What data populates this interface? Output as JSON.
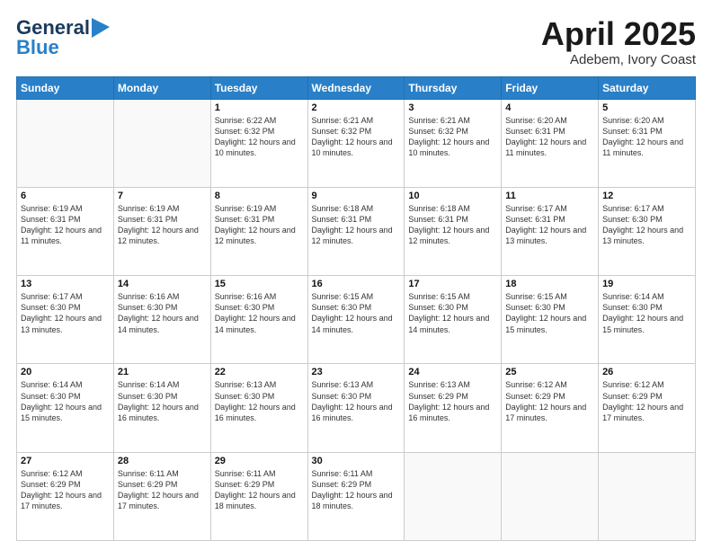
{
  "header": {
    "logo_general": "General",
    "logo_blue": "Blue",
    "month": "April 2025",
    "location": "Adebem, Ivory Coast"
  },
  "days_of_week": [
    "Sunday",
    "Monday",
    "Tuesday",
    "Wednesday",
    "Thursday",
    "Friday",
    "Saturday"
  ],
  "weeks": [
    [
      {
        "day": "",
        "info": ""
      },
      {
        "day": "",
        "info": ""
      },
      {
        "day": "1",
        "info": "Sunrise: 6:22 AM\nSunset: 6:32 PM\nDaylight: 12 hours and 10 minutes."
      },
      {
        "day": "2",
        "info": "Sunrise: 6:21 AM\nSunset: 6:32 PM\nDaylight: 12 hours and 10 minutes."
      },
      {
        "day": "3",
        "info": "Sunrise: 6:21 AM\nSunset: 6:32 PM\nDaylight: 12 hours and 10 minutes."
      },
      {
        "day": "4",
        "info": "Sunrise: 6:20 AM\nSunset: 6:31 PM\nDaylight: 12 hours and 11 minutes."
      },
      {
        "day": "5",
        "info": "Sunrise: 6:20 AM\nSunset: 6:31 PM\nDaylight: 12 hours and 11 minutes."
      }
    ],
    [
      {
        "day": "6",
        "info": "Sunrise: 6:19 AM\nSunset: 6:31 PM\nDaylight: 12 hours and 11 minutes."
      },
      {
        "day": "7",
        "info": "Sunrise: 6:19 AM\nSunset: 6:31 PM\nDaylight: 12 hours and 12 minutes."
      },
      {
        "day": "8",
        "info": "Sunrise: 6:19 AM\nSunset: 6:31 PM\nDaylight: 12 hours and 12 minutes."
      },
      {
        "day": "9",
        "info": "Sunrise: 6:18 AM\nSunset: 6:31 PM\nDaylight: 12 hours and 12 minutes."
      },
      {
        "day": "10",
        "info": "Sunrise: 6:18 AM\nSunset: 6:31 PM\nDaylight: 12 hours and 12 minutes."
      },
      {
        "day": "11",
        "info": "Sunrise: 6:17 AM\nSunset: 6:31 PM\nDaylight: 12 hours and 13 minutes."
      },
      {
        "day": "12",
        "info": "Sunrise: 6:17 AM\nSunset: 6:30 PM\nDaylight: 12 hours and 13 minutes."
      }
    ],
    [
      {
        "day": "13",
        "info": "Sunrise: 6:17 AM\nSunset: 6:30 PM\nDaylight: 12 hours and 13 minutes."
      },
      {
        "day": "14",
        "info": "Sunrise: 6:16 AM\nSunset: 6:30 PM\nDaylight: 12 hours and 14 minutes."
      },
      {
        "day": "15",
        "info": "Sunrise: 6:16 AM\nSunset: 6:30 PM\nDaylight: 12 hours and 14 minutes."
      },
      {
        "day": "16",
        "info": "Sunrise: 6:15 AM\nSunset: 6:30 PM\nDaylight: 12 hours and 14 minutes."
      },
      {
        "day": "17",
        "info": "Sunrise: 6:15 AM\nSunset: 6:30 PM\nDaylight: 12 hours and 14 minutes."
      },
      {
        "day": "18",
        "info": "Sunrise: 6:15 AM\nSunset: 6:30 PM\nDaylight: 12 hours and 15 minutes."
      },
      {
        "day": "19",
        "info": "Sunrise: 6:14 AM\nSunset: 6:30 PM\nDaylight: 12 hours and 15 minutes."
      }
    ],
    [
      {
        "day": "20",
        "info": "Sunrise: 6:14 AM\nSunset: 6:30 PM\nDaylight: 12 hours and 15 minutes."
      },
      {
        "day": "21",
        "info": "Sunrise: 6:14 AM\nSunset: 6:30 PM\nDaylight: 12 hours and 16 minutes."
      },
      {
        "day": "22",
        "info": "Sunrise: 6:13 AM\nSunset: 6:30 PM\nDaylight: 12 hours and 16 minutes."
      },
      {
        "day": "23",
        "info": "Sunrise: 6:13 AM\nSunset: 6:30 PM\nDaylight: 12 hours and 16 minutes."
      },
      {
        "day": "24",
        "info": "Sunrise: 6:13 AM\nSunset: 6:29 PM\nDaylight: 12 hours and 16 minutes."
      },
      {
        "day": "25",
        "info": "Sunrise: 6:12 AM\nSunset: 6:29 PM\nDaylight: 12 hours and 17 minutes."
      },
      {
        "day": "26",
        "info": "Sunrise: 6:12 AM\nSunset: 6:29 PM\nDaylight: 12 hours and 17 minutes."
      }
    ],
    [
      {
        "day": "27",
        "info": "Sunrise: 6:12 AM\nSunset: 6:29 PM\nDaylight: 12 hours and 17 minutes."
      },
      {
        "day": "28",
        "info": "Sunrise: 6:11 AM\nSunset: 6:29 PM\nDaylight: 12 hours and 17 minutes."
      },
      {
        "day": "29",
        "info": "Sunrise: 6:11 AM\nSunset: 6:29 PM\nDaylight: 12 hours and 18 minutes."
      },
      {
        "day": "30",
        "info": "Sunrise: 6:11 AM\nSunset: 6:29 PM\nDaylight: 12 hours and 18 minutes."
      },
      {
        "day": "",
        "info": ""
      },
      {
        "day": "",
        "info": ""
      },
      {
        "day": "",
        "info": ""
      }
    ]
  ]
}
